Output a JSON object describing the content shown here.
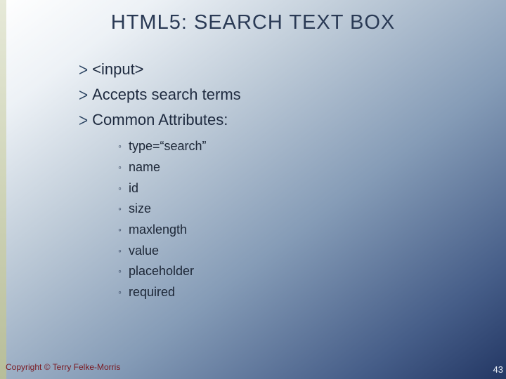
{
  "title": "HTML5: SEARCH TEXT BOX",
  "bullets": {
    "b0": "<input>",
    "b1": "Accepts search  terms",
    "b2": "Common Attributes:"
  },
  "attrs": {
    "a0": "type=“search”",
    "a1": "name",
    "a2": "id",
    "a3": "size",
    "a4": "maxlength",
    "a5": "value",
    "a6": "placeholder",
    "a7": "required"
  },
  "footer": {
    "copyright": "Copyright © Terry Felke-Morris",
    "page": "43"
  }
}
